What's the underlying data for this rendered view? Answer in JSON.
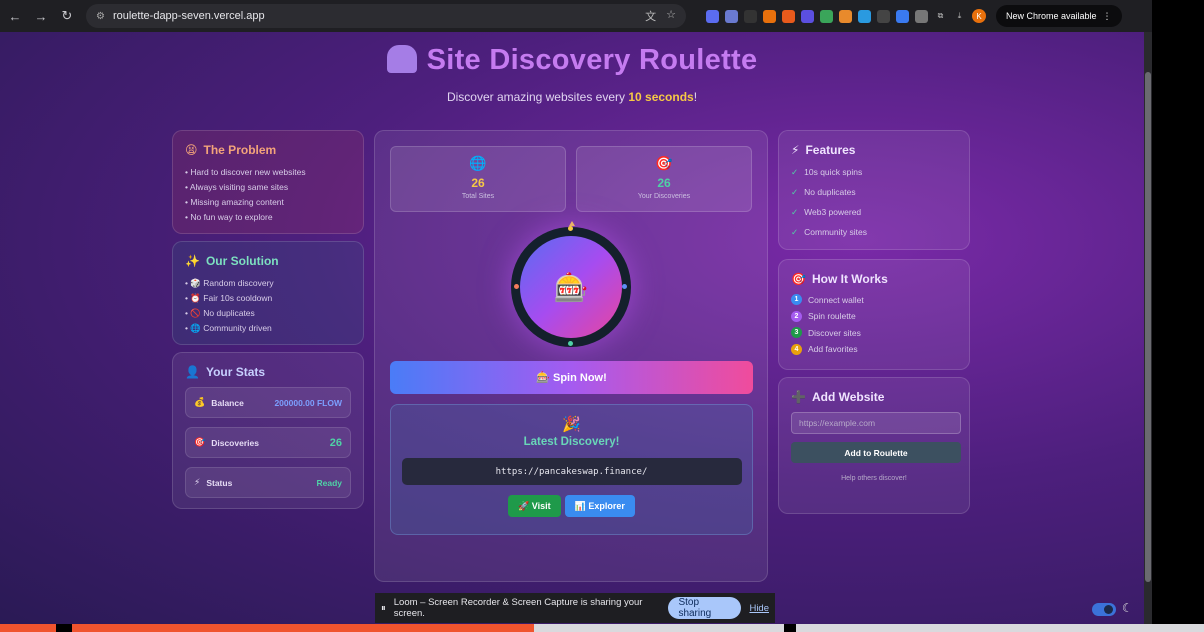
{
  "browser": {
    "url": "roulette-dapp-seven.vercel.app",
    "update_label": "New Chrome available",
    "profile_initial": "K"
  },
  "hero": {
    "title": "Site Discovery Roulette",
    "subtitle_pre": "Discover amazing websites every ",
    "subtitle_highlight": "10 seconds",
    "subtitle_post": "!"
  },
  "problem": {
    "title": "The Problem",
    "emoji": "😫",
    "items": [
      "• Hard to discover new websites",
      "• Always visiting same sites",
      "• Missing amazing content",
      "• No fun way to explore"
    ]
  },
  "solution": {
    "title": "Our Solution",
    "emoji": "✨",
    "items": [
      "• 🎲 Random discovery",
      "• ⏰ Fair 10s cooldown",
      "• 🚫 No duplicates",
      "• 🌐 Community driven"
    ]
  },
  "stats": {
    "title": "Your Stats",
    "emoji": "👤",
    "rows": [
      {
        "emoji": "💰",
        "label": "Balance",
        "value": "200000.00 FLOW",
        "color": "#7ca0ff"
      },
      {
        "emoji": "🎯",
        "label": "Discoveries",
        "value": "26",
        "color": "#4fd1a6"
      },
      {
        "emoji": "⚡",
        "label": "Status",
        "value": "Ready",
        "color": "#4fd1a6"
      }
    ]
  },
  "counters": {
    "total": {
      "emoji": "🌐",
      "value": "26",
      "label": "Total Sites"
    },
    "mine": {
      "emoji": "🎯",
      "value": "26",
      "label": "Your Discoveries"
    }
  },
  "wheel": {
    "emoji": "🎰"
  },
  "spin": {
    "label": "🎰 Spin Now!"
  },
  "latest": {
    "emoji": "🎉",
    "title": "Latest Discovery!",
    "url": "https://pancakeswap.finance/",
    "visit_label": "🚀 Visit",
    "explorer_label": "📊 Explorer"
  },
  "features": {
    "title": "Features",
    "emoji": "⚡",
    "items": [
      "10s quick spins",
      "No duplicates",
      "Web3 powered",
      "Community sites"
    ]
  },
  "how": {
    "title": "How It Works",
    "emoji": "🎯",
    "steps": [
      {
        "n": "1",
        "label": "Connect wallet",
        "color": "#3a8cf0"
      },
      {
        "n": "2",
        "label": "Spin roulette",
        "color": "#a55bf0"
      },
      {
        "n": "3",
        "label": "Discover sites",
        "color": "#1f9a4a"
      },
      {
        "n": "4",
        "label": "Add favorites",
        "color": "#e8a10c"
      }
    ]
  },
  "add": {
    "title": "Add Website",
    "emoji": "➕",
    "placeholder": "https://example.com",
    "button": "Add to Roulette",
    "note": "Help others discover!"
  },
  "loom": {
    "message": "Loom – Screen Recorder & Screen Capture is sharing your screen.",
    "stop_label": "Stop sharing",
    "hide_label": "Hide"
  }
}
